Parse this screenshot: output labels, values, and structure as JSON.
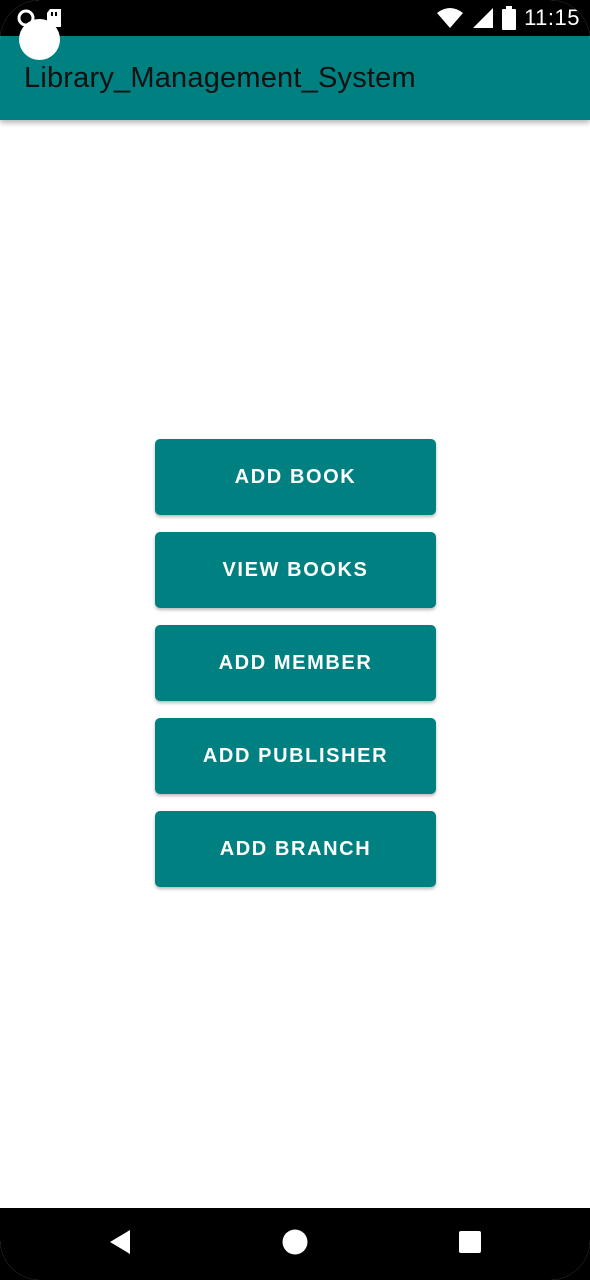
{
  "status_bar": {
    "time": "11:15",
    "icons": [
      "sim-card-icon",
      "wifi-icon",
      "signal-icon",
      "battery-icon"
    ]
  },
  "app_bar": {
    "title": "Library_Management_System",
    "background_color": "#008080"
  },
  "buttons": [
    {
      "label": "ADD BOOK"
    },
    {
      "label": "VIEW BOOKS"
    },
    {
      "label": "ADD MEMBER"
    },
    {
      "label": "ADD PUBLISHER"
    },
    {
      "label": "ADD BRANCH"
    }
  ],
  "theme": {
    "accent": "#008080",
    "button_text": "#ffffff",
    "title_text": "#111111"
  },
  "nav_bar": {
    "icons": [
      "back-icon",
      "home-icon",
      "recents-icon"
    ]
  }
}
